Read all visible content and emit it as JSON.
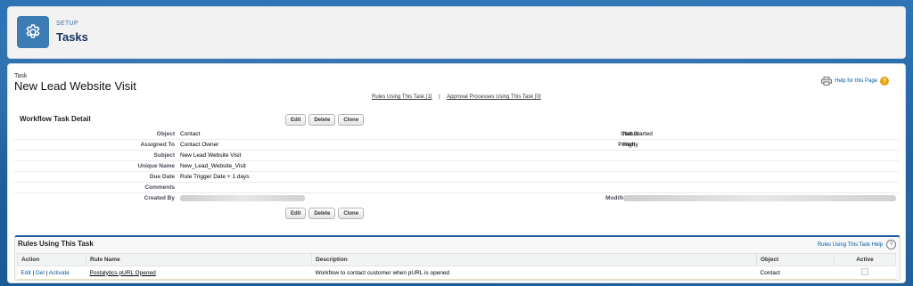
{
  "header": {
    "section_label": "SETUP",
    "title": "Tasks",
    "icon": "gear-icon"
  },
  "record": {
    "type_label": "Task",
    "title": "New Lead Website Visit",
    "help_link": "Help for this Page",
    "related_links": [
      "Rules Using This Task [1]",
      "Approval Processes Using This Task [0]"
    ],
    "related_separator": "|"
  },
  "detail": {
    "heading": "Workflow Task Detail",
    "buttons": {
      "edit": "Edit",
      "delete": "Delete",
      "clone": "Clone"
    },
    "fields": {
      "object_label": "Object",
      "object_value": "Contact",
      "assigned_label": "Assigned To",
      "assigned_value": "Contact Owner",
      "subject_label": "Subject",
      "subject_value": "New Lead Website Visit",
      "unique_label": "Unique Name",
      "unique_value": "New_Lead_Website_Visit",
      "due_label": "Due Date",
      "due_value": "Rule Trigger Date + 1 days",
      "comments_label": "Comments",
      "comments_value": "",
      "created_label": "Created By",
      "status_label": "Status",
      "status_value": "Not Started",
      "priority_label": "Priority",
      "priority_value": "High",
      "modified_label": "Modified By"
    }
  },
  "rules": {
    "heading": "Rules Using This Task",
    "help_link": "Rules Using This Task Help",
    "columns": [
      "Action",
      "Rule Name",
      "Description",
      "Object",
      "Active"
    ],
    "row": {
      "action_edit": "Edit",
      "action_del": "Del",
      "action_activate": "Activate",
      "action_sep": "|",
      "rule_name": "Postalytics pURL Opened",
      "description": "Workflow to contact customer when pURL is opened",
      "object": "Contact",
      "active": false
    }
  },
  "colors": {
    "brand_blue": "#1b5f9e",
    "link": "#015ba7",
    "help_orange": "#e8a20e"
  }
}
